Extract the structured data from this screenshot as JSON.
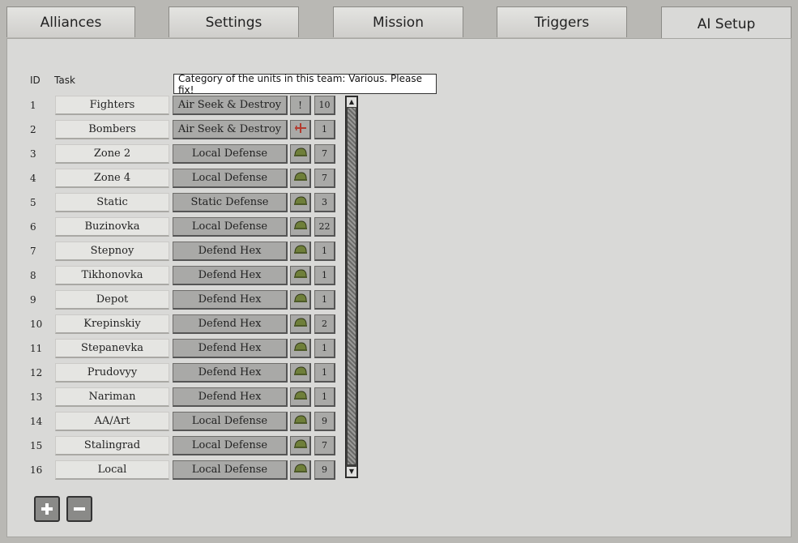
{
  "tabs": [
    {
      "label": "Alliances",
      "active": false
    },
    {
      "label": "Settings",
      "active": false
    },
    {
      "label": "Mission",
      "active": false
    },
    {
      "label": "Triggers",
      "active": false
    },
    {
      "label": "AI Setup",
      "active": true
    }
  ],
  "table": {
    "header_id": "ID",
    "header_task": "Task",
    "rows": [
      {
        "id": "1",
        "task": "Fighters",
        "order": "Air Seek & Destroy",
        "category": "!",
        "count": "10"
      },
      {
        "id": "2",
        "task": "Bombers",
        "order": "Air Seek & Destroy",
        "category": "plane-icon",
        "count": "1"
      },
      {
        "id": "3",
        "task": "Zone 2",
        "order": "Local Defense",
        "category": "helmet-icon",
        "count": "7"
      },
      {
        "id": "4",
        "task": "Zone 4",
        "order": "Local Defense",
        "category": "helmet-icon",
        "count": "7"
      },
      {
        "id": "5",
        "task": "Static",
        "order": "Static Defense",
        "category": "helmet-icon",
        "count": "3"
      },
      {
        "id": "6",
        "task": "Buzinovka",
        "order": "Local Defense",
        "category": "helmet-icon",
        "count": "22"
      },
      {
        "id": "7",
        "task": "Stepnoy",
        "order": "Defend Hex",
        "category": "helmet-icon",
        "count": "1"
      },
      {
        "id": "8",
        "task": "Tikhonovka",
        "order": "Defend Hex",
        "category": "helmet-icon",
        "count": "1"
      },
      {
        "id": "9",
        "task": "Depot",
        "order": "Defend Hex",
        "category": "helmet-icon",
        "count": "1"
      },
      {
        "id": "10",
        "task": "Krepinskiy",
        "order": "Defend Hex",
        "category": "helmet-icon",
        "count": "2"
      },
      {
        "id": "11",
        "task": "Stepanevka",
        "order": "Defend Hex",
        "category": "helmet-icon",
        "count": "1"
      },
      {
        "id": "12",
        "task": "Prudovyy",
        "order": "Defend Hex",
        "category": "helmet-icon",
        "count": "1"
      },
      {
        "id": "13",
        "task": "Nariman",
        "order": "Defend Hex",
        "category": "helmet-icon",
        "count": "1"
      },
      {
        "id": "14",
        "task": "AA/Art",
        "order": "Local Defense",
        "category": "helmet-icon",
        "count": "9"
      },
      {
        "id": "15",
        "task": "Stalingrad",
        "order": "Local Defense",
        "category": "helmet-icon",
        "count": "7"
      },
      {
        "id": "16",
        "task": "Local",
        "order": "Local Defense",
        "category": "helmet-icon",
        "count": "9"
      }
    ]
  },
  "tooltip": "Category of the units in this team: Various. Please fix!",
  "colors": {
    "helmet": "#6f7f3a",
    "plane": "#b33a2e"
  }
}
